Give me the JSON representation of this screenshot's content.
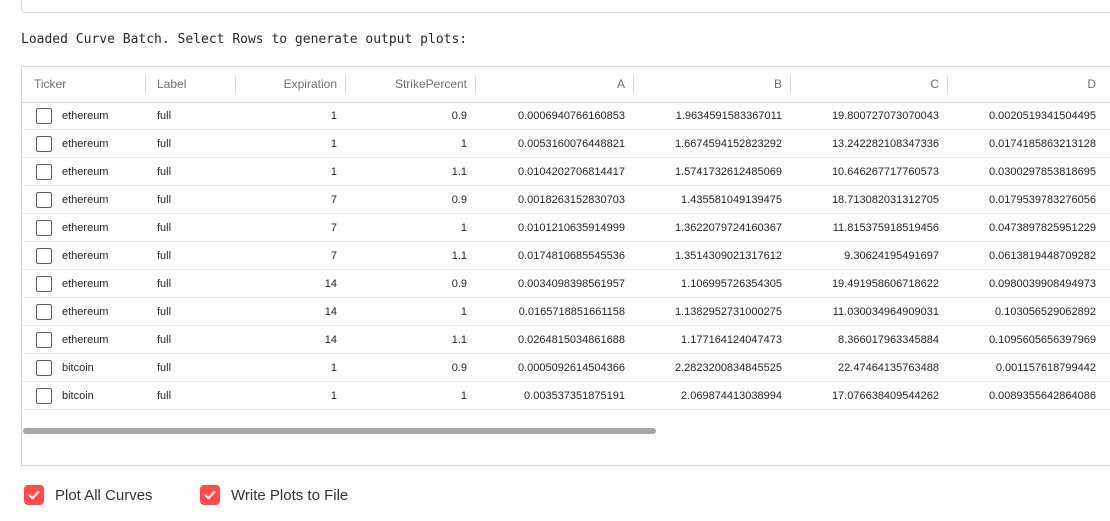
{
  "status_text": "Loaded Curve Batch. Select Rows to generate output plots:",
  "table": {
    "columns": [
      "Ticker",
      "Label",
      "Expiration",
      "StrikePercent",
      "A",
      "B",
      "C",
      "D"
    ],
    "rows": [
      [
        "ethereum",
        "full",
        "1",
        "0.9",
        "0.0006940766160853",
        "1.9634591583367011",
        "19.800727073070043",
        "0.0020519341504495"
      ],
      [
        "ethereum",
        "full",
        "1",
        "1",
        "0.0053160076448821",
        "1.6674594152823292",
        "13.242282108347336",
        "0.0174185863213128"
      ],
      [
        "ethereum",
        "full",
        "1",
        "1.1",
        "0.0104202706814417",
        "1.5741732612485069",
        "10.646267717760573",
        "0.0300297853818695"
      ],
      [
        "ethereum",
        "full",
        "7",
        "0.9",
        "0.0018263152830703",
        "1.435581049139475",
        "18.713082031312705",
        "0.0179539783276056"
      ],
      [
        "ethereum",
        "full",
        "7",
        "1",
        "0.0101210635914999",
        "1.3622079724160367",
        "11.815375918519456",
        "0.0473897825951229"
      ],
      [
        "ethereum",
        "full",
        "7",
        "1.1",
        "0.0174810685545536",
        "1.3514309021317612",
        "9.30624195491697",
        "0.0613819448709282"
      ],
      [
        "ethereum",
        "full",
        "14",
        "0.9",
        "0.0034098398561957",
        "1.106995726354305",
        "19.491958606718622",
        "0.0980039908494973"
      ],
      [
        "ethereum",
        "full",
        "14",
        "1",
        "0.0165718851661158",
        "1.1382952731000275",
        "11.030034964909031",
        "0.103056529062892"
      ],
      [
        "ethereum",
        "full",
        "14",
        "1.1",
        "0.0264815034861688",
        "1.177164124047473",
        "8.366017963345884",
        "0.1095605656397969"
      ],
      [
        "bitcoin",
        "full",
        "1",
        "0.9",
        "0.0005092614504366",
        "2.2823200834845525",
        "22.47464135763488",
        "0.001157618799442"
      ],
      [
        "bitcoin",
        "full",
        "1",
        "1",
        "0.003537351875191",
        "2.069874413038994",
        "17.076638409544262",
        "0.0089355642864086"
      ]
    ]
  },
  "checkboxes": [
    {
      "label": "Plot All Curves",
      "checked": true
    },
    {
      "label": "Write Plots to File",
      "checked": true
    }
  ],
  "colors": {
    "accent": "#ff4b4b",
    "checkmark": "#ffffff"
  }
}
